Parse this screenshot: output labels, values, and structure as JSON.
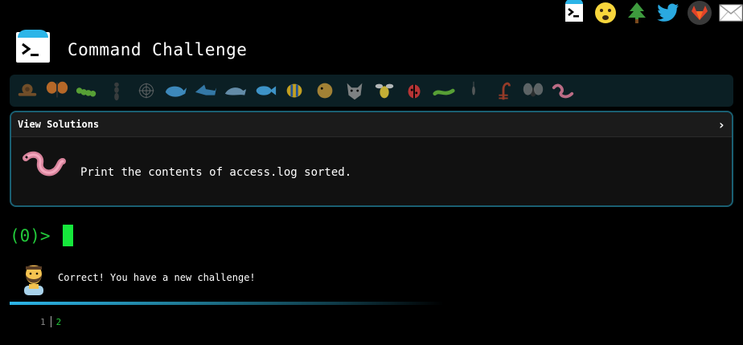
{
  "header": {
    "title": "Command Challenge"
  },
  "social": [
    {
      "name": "terminal-icon"
    },
    {
      "name": "shush-emoji-icon"
    },
    {
      "name": "tree-icon"
    },
    {
      "name": "twitter-icon"
    },
    {
      "name": "gitlab-icon"
    },
    {
      "name": "mail-icon"
    }
  ],
  "critters": [
    {
      "name": "snail",
      "color": "#8b5a2b"
    },
    {
      "name": "butterfly",
      "color": "#e07b2a"
    },
    {
      "name": "caterpillar",
      "color": "#6bbf3a"
    },
    {
      "name": "ant",
      "color": "#444444"
    },
    {
      "name": "spider-web",
      "color": "#777777"
    },
    {
      "name": "whale",
      "color": "#4aa3e0"
    },
    {
      "name": "shark",
      "color": "#3f8fc7"
    },
    {
      "name": "dolphin",
      "color": "#7aa6c8"
    },
    {
      "name": "fish",
      "color": "#4ab0f0"
    },
    {
      "name": "tropical-fish",
      "color": "#f0c020"
    },
    {
      "name": "blowfish",
      "color": "#c89a3a"
    },
    {
      "name": "wolf",
      "color": "#9a9a9a"
    },
    {
      "name": "bee",
      "color": "#f2d23a"
    },
    {
      "name": "ladybug",
      "color": "#e23a3a"
    },
    {
      "name": "worm-green",
      "color": "#6bbf3a"
    },
    {
      "name": "mosquito",
      "color": "#666666"
    },
    {
      "name": "scorpion",
      "color": "#b8432a"
    },
    {
      "name": "fly",
      "color": "#8a8a8a"
    },
    {
      "name": "worm-pink",
      "color": "#e7809e"
    }
  ],
  "panel": {
    "view_solutions": "View Solutions",
    "chevron": "›",
    "task": "Print the contents of access.log sorted."
  },
  "prompt": {
    "text": "(0)>"
  },
  "message": {
    "text": "Correct! You have a new challenge!"
  },
  "steps": {
    "previous": "1",
    "current": "2"
  },
  "colors": {
    "accent": "#2cb5e8",
    "prompt_green": "#22c93a",
    "panel_border": "#1a5f72"
  }
}
